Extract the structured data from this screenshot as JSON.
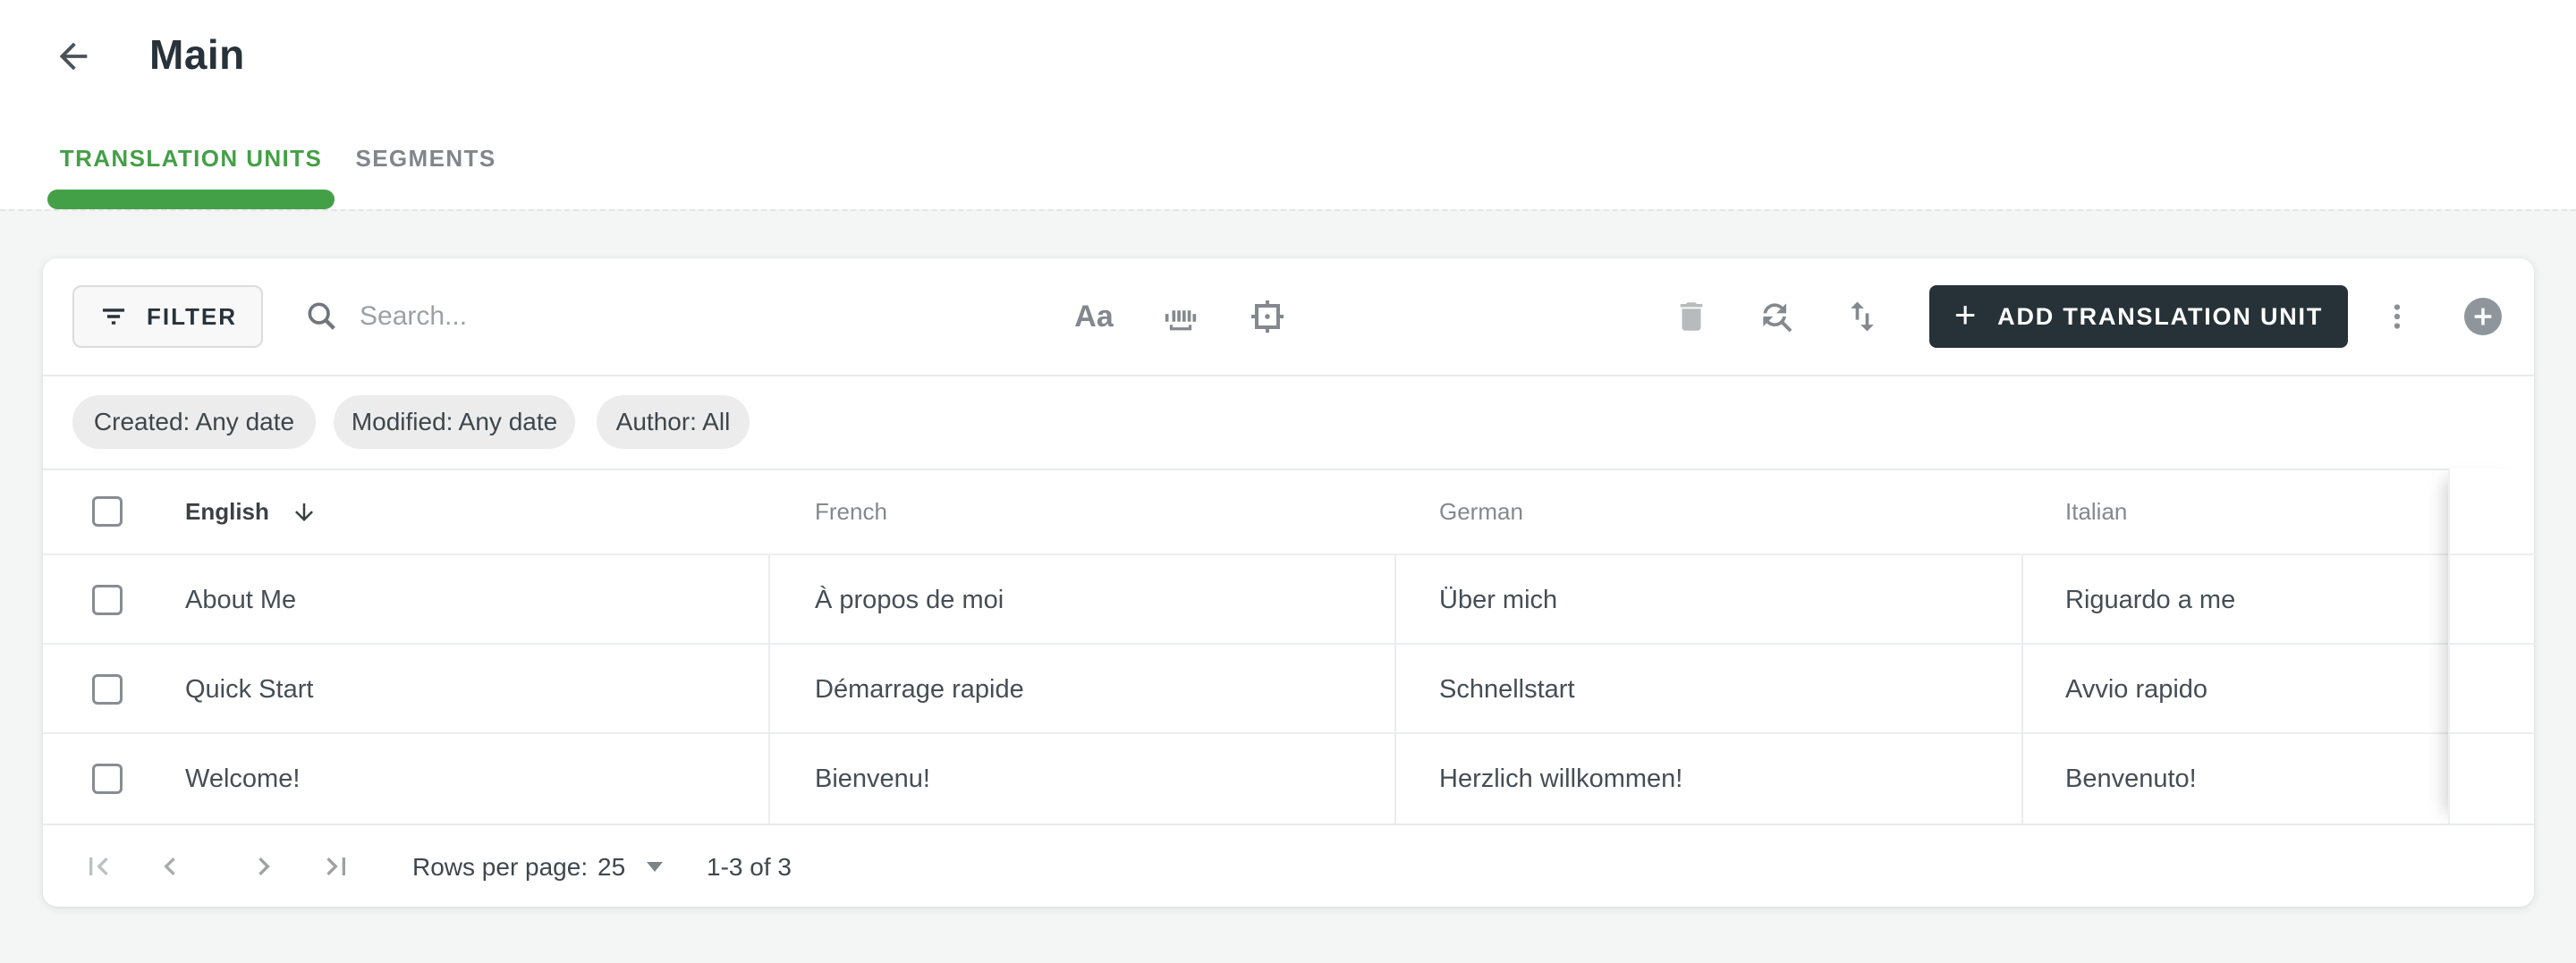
{
  "header": {
    "title": "Main"
  },
  "tabs": {
    "items": [
      {
        "label": "TRANSLATION UNITS",
        "active": true
      },
      {
        "label": "SEGMENTS",
        "active": false
      }
    ]
  },
  "toolbar": {
    "filter_label": "FILTER",
    "search_placeholder": "Search...",
    "match_case_label": "Aa",
    "add_button_plus": "+",
    "add_button_label": "ADD TRANSLATION UNIT"
  },
  "filters": {
    "chips": [
      "Created: Any date",
      "Modified: Any date",
      "Author: All"
    ]
  },
  "table": {
    "columns": [
      "English",
      "French",
      "German",
      "Italian"
    ],
    "sorted_column": "English",
    "sort_direction": "descending",
    "rows": [
      {
        "en": "About Me",
        "fr": "À propos de moi",
        "de": "Über mich",
        "it": "Riguardo a me"
      },
      {
        "en": "Quick Start",
        "fr": "Démarrage rapide",
        "de": "Schnellstart",
        "it": "Avvio rapido"
      },
      {
        "en": "Welcome!",
        "fr": "Bienvenu!",
        "de": "Herzlich willkommen!",
        "it": "Benvenuto!"
      }
    ]
  },
  "pagination": {
    "rows_per_page_label": "Rows per page:",
    "rows_per_page_value": "25",
    "range_label": "1-3 of 3"
  },
  "colors": {
    "accent_green": "#43a047",
    "dark_button_bg": "#263238",
    "page_bg": "#f4f5f5",
    "chip_bg": "#ececec",
    "text_dark": "#3c4043",
    "text_gray": "#85898d"
  }
}
